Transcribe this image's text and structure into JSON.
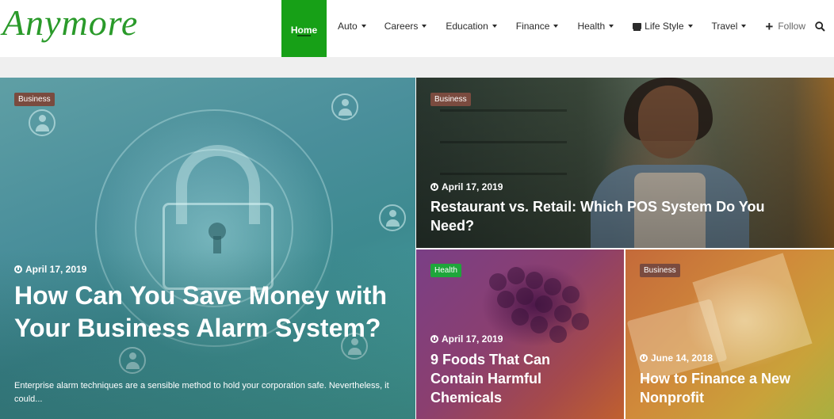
{
  "header": {
    "logo": "Anymore",
    "nav": [
      {
        "label": "Home",
        "has_caret": false,
        "active": true
      },
      {
        "label": "Auto",
        "has_caret": true
      },
      {
        "label": "Careers",
        "has_caret": true
      },
      {
        "label": "Education",
        "has_caret": true
      },
      {
        "label": "Finance",
        "has_caret": true
      },
      {
        "label": "Health",
        "has_caret": true
      },
      {
        "label": "Life Style",
        "has_caret": true,
        "icon": "tv-icon"
      },
      {
        "label": "Travel",
        "has_caret": true
      }
    ],
    "follow_label": "Follow",
    "follow_icon": "plus-icon",
    "search_icon": "search-icon"
  },
  "colors": {
    "accent": "#17a017",
    "logo": "#2a9a2a",
    "badge_business": "#7a4b3f",
    "badge_health": "#1ea63a",
    "band": "#efefef"
  },
  "posts": {
    "main": {
      "category": "Business",
      "date": "April 17, 2019",
      "title": "How Can You Save Money with Your Business Alarm System?",
      "excerpt": "Enterprise alarm techniques are a sensible method to hold your corporation safe. Nevertheless, it could..."
    },
    "restaurant": {
      "category": "Business",
      "date": "April 17, 2019",
      "title": "Restaurant vs. Retail: Which POS System Do You Need?"
    },
    "foods": {
      "category": "Health",
      "date": "April 17, 2019",
      "title": "9 Foods That Can Contain Harmful Chemicals"
    },
    "finance": {
      "category": "Business",
      "date": "June 14, 2018",
      "title": "How to Finance a New Nonprofit"
    }
  }
}
